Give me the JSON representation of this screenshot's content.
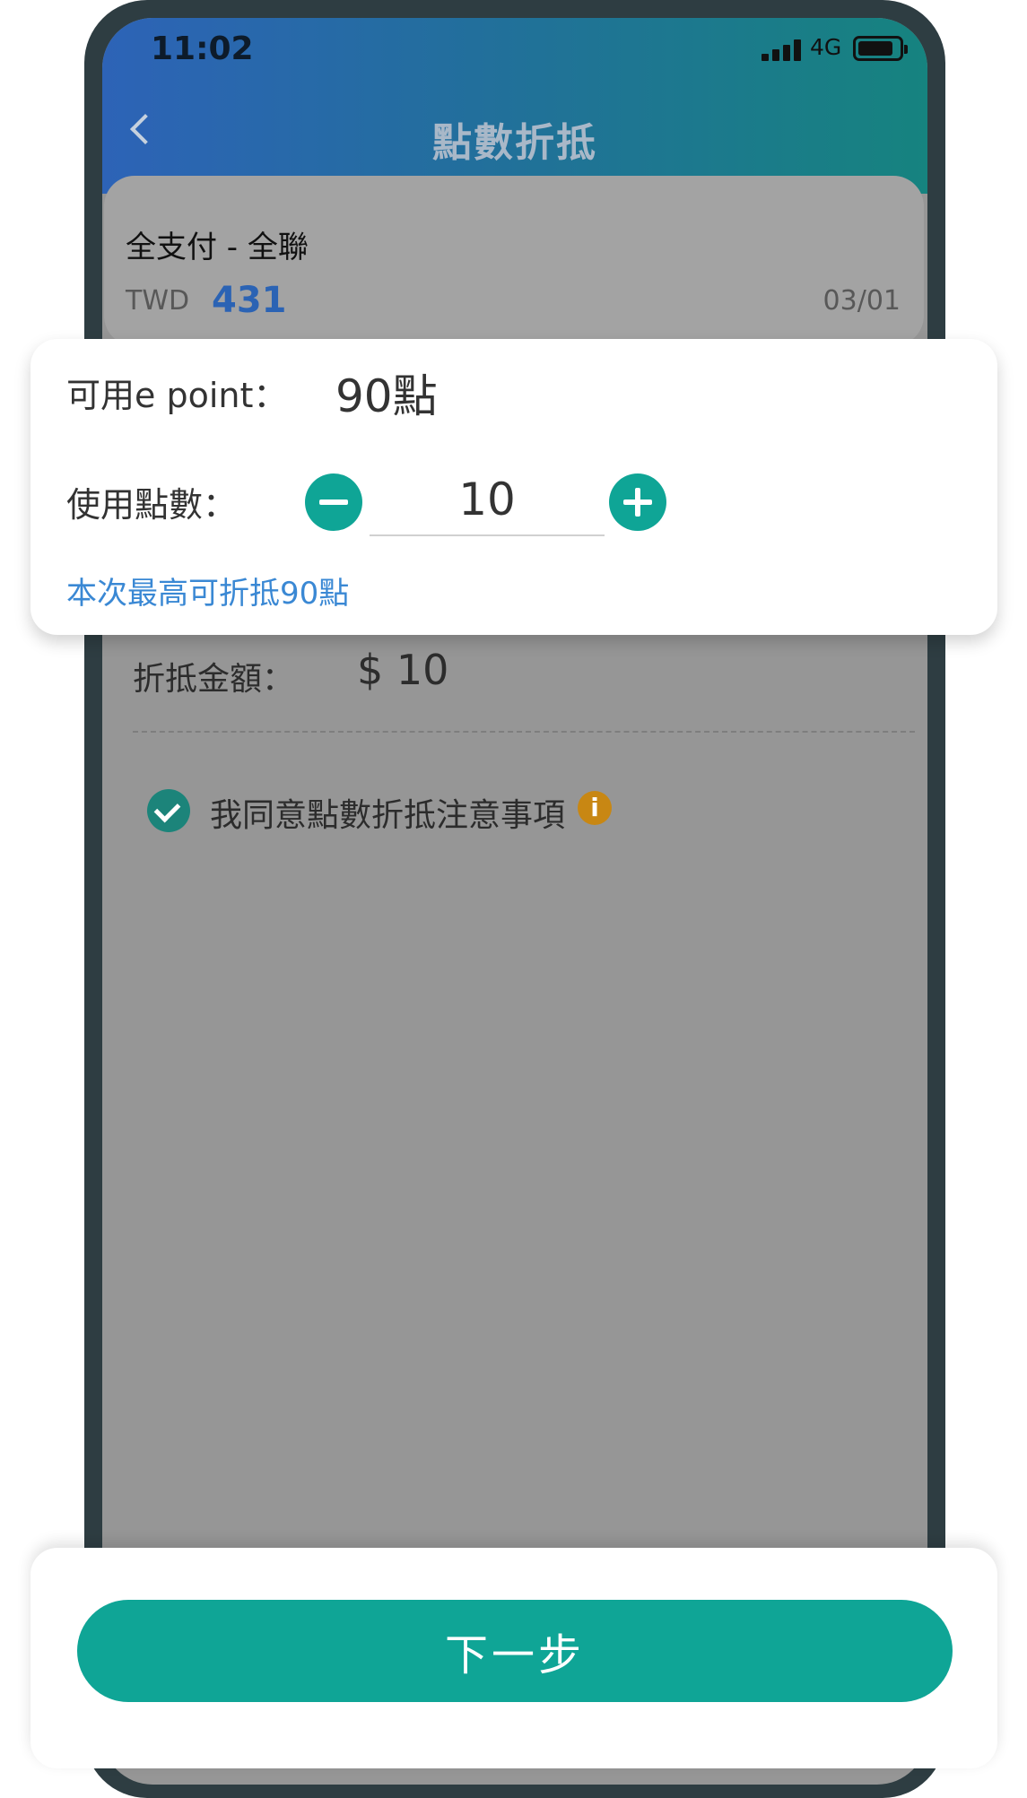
{
  "status_bar": {
    "time": "11:02",
    "network": "4G"
  },
  "header": {
    "title": "點數折抵"
  },
  "card": {
    "title": "全支付 - 全聯",
    "currency": "TWD",
    "amount": "431",
    "date": "03/01"
  },
  "points": {
    "available_label": "可用e point：",
    "available_value": "90點",
    "use_label": "使用點數：",
    "use_value": "10",
    "max_note": "本次最高可折抵90點"
  },
  "discount": {
    "label": "折抵金額：",
    "value": "$ 10"
  },
  "agreement": {
    "checked": true,
    "text": "我同意點數折抵注意事項",
    "info_glyph": "i"
  },
  "footer": {
    "next_label": "下一步"
  },
  "colors": {
    "accent": "#0fa596",
    "link": "#3a88d4",
    "amount": "#2b63b4",
    "info": "#c88713"
  }
}
